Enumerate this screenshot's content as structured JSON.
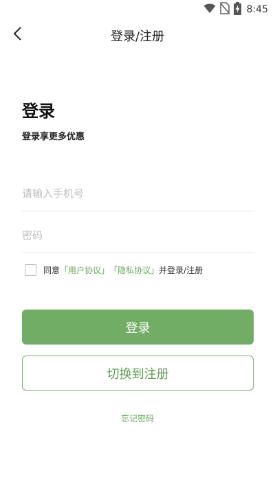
{
  "status_bar": {
    "time": "8:45",
    "icons": [
      "wifi-icon",
      "no-sim-icon",
      "battery-charging-icon"
    ]
  },
  "header": {
    "back_icon": "chevron-left-icon",
    "title": "登录/注册"
  },
  "login": {
    "title": "登录",
    "subtitle": "登录享更多优惠",
    "phone_placeholder": "请输入手机号",
    "password_placeholder": "密码"
  },
  "agreement": {
    "prefix": "同意",
    "user_agreement": "「用户协议」",
    "privacy_agreement": "「隐私协议」",
    "suffix": "并登录/注册"
  },
  "buttons": {
    "login": "登录",
    "switch_register": "切换到注册"
  },
  "forgot_password": "忘记密码",
  "colors": {
    "accent": "#72ad66",
    "link": "#6aa85e"
  }
}
